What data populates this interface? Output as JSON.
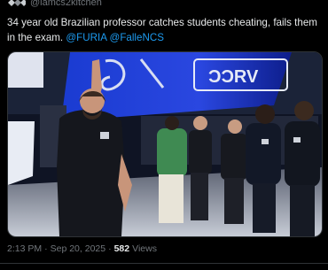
{
  "author": {
    "handle": "@iamcs2kitchen",
    "logo_icon": "kitchen-logo-icon"
  },
  "tweet": {
    "text_main": "34 year old Brazilian professor catches students cheating, fails them in the exam.",
    "mentions": [
      "@FURIA",
      "@FalleNCS"
    ]
  },
  "media": {
    "icon": "video-still-image",
    "colors": {
      "backdrop_blue": "#1a3bd1",
      "stage_dark": "#0f1424",
      "floor": "#b8bdc8"
    }
  },
  "meta": {
    "time": "2:13 PM",
    "separator": "·",
    "date": "Sep 20, 2025",
    "separator2": "·",
    "views_count": "582",
    "views_label": "Views"
  },
  "colors": {
    "background": "#000000",
    "text": "#e7e9ea",
    "muted": "#71767b",
    "link": "#1d9bf0",
    "border": "#2f3336"
  }
}
